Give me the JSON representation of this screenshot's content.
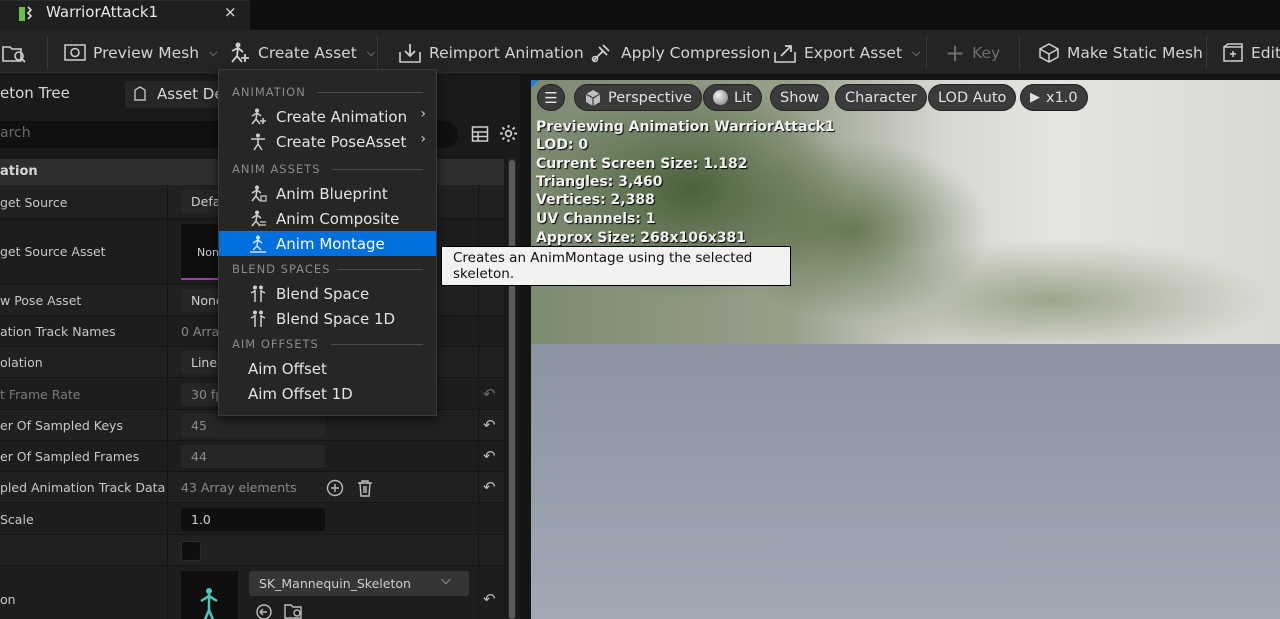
{
  "window": {
    "tab_title": "WarriorAttack1",
    "close": "×"
  },
  "toolbar": {
    "preview_mesh": "Preview Mesh",
    "create_asset": "Create Asset",
    "reimport": "Reimport Animation",
    "apply_compression": "Apply Compression",
    "export_asset": "Export Asset",
    "key": "Key",
    "make_static_mesh": "Make Static Mesh",
    "edit": "Edit"
  },
  "left_panel": {
    "tab_skeleton_tree": "eton Tree",
    "tab_asset_details": "Asset De",
    "search_placeholder": "arch",
    "section_title": "ation",
    "rows": [
      {
        "label": "get Source",
        "value": "Defau"
      },
      {
        "label": "get Source Asset",
        "value": "None"
      },
      {
        "label": "w Pose Asset",
        "value": "None"
      },
      {
        "label": "ation Track Names",
        "value": "0 Array"
      },
      {
        "label": "olation",
        "value": "Linea"
      },
      {
        "label": "t Frame Rate",
        "value": "30 fp"
      },
      {
        "label": "er Of Sampled Keys",
        "value": "45"
      },
      {
        "label": "er Of Sampled Frames",
        "value": "44"
      },
      {
        "label": "pled Animation Track Data",
        "value": "43 Array elements"
      },
      {
        "label": "Scale",
        "value": "1.0"
      },
      {
        "label": "",
        "value": ""
      },
      {
        "label": "on",
        "value": "SK_Mannequin_Skeleton"
      }
    ]
  },
  "menu": {
    "sections": {
      "animation": "ANIMATION",
      "anim_assets": "ANIM ASSETS",
      "blend_spaces": "BLEND SPACES",
      "aim_offsets": "AIM OFFSETS"
    },
    "items": {
      "create_animation": "Create Animation",
      "create_pose_asset": "Create PoseAsset",
      "anim_blueprint": "Anim Blueprint",
      "anim_composite": "Anim Composite",
      "anim_montage": "Anim Montage",
      "blend_space": "Blend Space",
      "blend_space_1d": "Blend Space 1D",
      "aim_offset": "Aim Offset",
      "aim_offset_1d": "Aim Offset 1D"
    },
    "arrow": "›"
  },
  "tooltip": "Creates an AnimMontage using the selected skeleton.",
  "viewport": {
    "perspective": "Perspective",
    "lit": "Lit",
    "show": "Show",
    "character": "Character",
    "lod_auto": "LOD Auto",
    "speed": "x1.0",
    "info": [
      "Previewing Animation WarriorAttack1",
      "LOD: 0",
      "Current Screen Size: 1.182",
      "Triangles: 3,460",
      "Vertices: 2,388",
      "UV Channels: 1",
      "Approx Size: 268x106x381"
    ]
  },
  "colors": {
    "accent": "#0070e0",
    "menu_bg": "#262626",
    "toolbar_bg": "#242424"
  }
}
